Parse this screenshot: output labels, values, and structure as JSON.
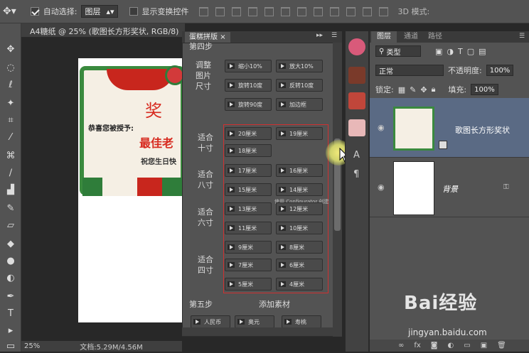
{
  "options_bar": {
    "auto_select_label": "自动选择:",
    "auto_select_value": "图层",
    "show_transform_label": "显示变换控件",
    "mode_label": "3D 模式:"
  },
  "document": {
    "tab_title": "A4糖纸 @ 25% (歌图长方形奖状, RGB/8)",
    "zoom": "25%",
    "doc_size": "文档:5.29M/4.56M"
  },
  "certificate": {
    "award_char": "奖",
    "line1": "恭喜您被授予:",
    "line2": "最佳老",
    "line3": "祝您生日快"
  },
  "plugin_panel": {
    "tab_label": "蛋糕拼版",
    "step4": "第四步",
    "adjust_label": "调整图片尺寸",
    "adjust_buttons": [
      "缩小10%",
      "放大10%",
      "旋转10度",
      "反转10度",
      "旋转90度",
      "加边框"
    ],
    "groups": [
      {
        "label": "适合十寸",
        "buttons": [
          "20厘米",
          "19厘米",
          "18厘米"
        ]
      },
      {
        "label": "适合八寸",
        "buttons": [
          "17厘米",
          "16厘米",
          "15厘米",
          "14厘米"
        ]
      },
      {
        "label": "适合六寸",
        "buttons": [
          "13厘米",
          "12厘米",
          "11厘米",
          "10厘米"
        ]
      },
      {
        "label": "适合四寸",
        "buttons": [
          "9厘米",
          "8厘米",
          "7厘米",
          "6厘米",
          "5厘米",
          "4厘米"
        ]
      }
    ],
    "tooltip": "使用 Configurator 创建",
    "step5": "第五步",
    "add_material": "添加素材",
    "material_buttons": [
      "人民币",
      "奥元",
      "寿桃"
    ]
  },
  "layers_panel": {
    "tabs": [
      "图层",
      "通道",
      "路径"
    ],
    "filter_value": "类型",
    "blend_mode": "正常",
    "opacity_label": "不透明度:",
    "opacity_value": "100%",
    "lock_label": "锁定:",
    "fill_label": "填充:",
    "fill_value": "100%",
    "layers": [
      {
        "name": "歌图长方形奖状"
      },
      {
        "name": "背景"
      }
    ]
  },
  "watermark": {
    "brand": "Bai经验",
    "url": "jingyan.baidu.com"
  },
  "colors": {
    "accent_red": "#d03030",
    "panel_bg": "#535353",
    "selected_layer": "#5a6a84"
  }
}
